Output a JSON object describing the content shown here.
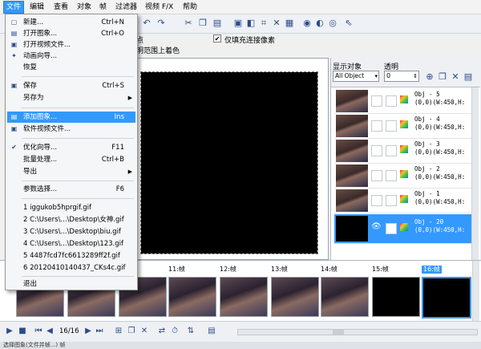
{
  "menubar": {
    "items": [
      {
        "label": "文件",
        "active": true
      },
      {
        "label": "编辑"
      },
      {
        "label": "查看"
      },
      {
        "label": "对象"
      },
      {
        "label": "帧"
      },
      {
        "label": "过滤器"
      },
      {
        "label": "视频 F/X"
      },
      {
        "label": "帮助"
      }
    ]
  },
  "file_menu": {
    "items": [
      {
        "label": "新建...",
        "shortcut": "Ctrl+N",
        "icon": "new-icon"
      },
      {
        "label": "打开图象...",
        "shortcut": "Ctrl+O",
        "icon": "open-icon"
      },
      {
        "label": "打开视频文件...",
        "shortcut": "",
        "icon": "video-open-icon"
      },
      {
        "label": "动画向导...",
        "shortcut": "",
        "icon": "wizard-icon"
      },
      {
        "label": "恢复",
        "shortcut": "",
        "icon": ""
      },
      {
        "label": "保存",
        "shortcut": "Ctrl+S",
        "icon": "save-icon"
      },
      {
        "label": "另存为",
        "shortcut": "",
        "icon": "",
        "submenu": true
      },
      {
        "label": "添加图象...",
        "shortcut": "Ins",
        "icon": "add-image-icon",
        "highlighted": true
      },
      {
        "label": "软件视频文件...",
        "shortcut": "",
        "icon": "video-file-icon"
      },
      {
        "label": "优化向导...",
        "shortcut": "F11",
        "icon": "optimize-icon"
      },
      {
        "label": "批量处理...",
        "shortcut": "Ctrl+B",
        "icon": ""
      },
      {
        "label": "导出",
        "shortcut": "",
        "icon": "",
        "submenu": true
      },
      {
        "label": "参数选择...",
        "shortcut": "F6",
        "icon": ""
      },
      {
        "label": "1 iggukob5hprgif.gif",
        "shortcut": "",
        "icon": ""
      },
      {
        "label": "2 C:\\Users\\...\\Desktop\\女神.gif",
        "shortcut": "",
        "icon": ""
      },
      {
        "label": "3 C:\\Users\\...\\Desktop\\biu.gif",
        "shortcut": "",
        "icon": ""
      },
      {
        "label": "4 C:\\Users\\...\\Desktop\\123.gif",
        "shortcut": "",
        "icon": ""
      },
      {
        "label": "5 4487fcd7fc6613289ff2f.gif",
        "shortcut": "",
        "icon": ""
      },
      {
        "label": "6 20120410140437_CKs4c.gif",
        "shortcut": "",
        "icon": ""
      },
      {
        "label": "退出",
        "shortcut": "",
        "icon": ""
      }
    ],
    "submenu_arrow": "▶"
  },
  "options": {
    "point_label": "点",
    "only_fill_label": "仅填充连接像素",
    "only_fill_checked": "✔",
    "tint_label": "明范围上着色"
  },
  "right_panel": {
    "show_objects_label": "显示对象",
    "transparency_label": "透明",
    "show_objects_value": "All Object",
    "transparency_value": "0",
    "objects": [
      {
        "name": "Obj - 5",
        "coords": "(0,0)(W:450,H:"
      },
      {
        "name": "Obj - 4",
        "coords": "(0,0)(W:450,H:"
      },
      {
        "name": "Obj - 3",
        "coords": "(0,0)(W:450,H:"
      },
      {
        "name": "Obj - 2",
        "coords": "(0,0)(W:450,H:"
      },
      {
        "name": "Obj - 1",
        "coords": "(0,0)(W:450,H:"
      },
      {
        "name": "Obj - 20",
        "coords": "(0,0)(W:450,H:",
        "selected": true
      }
    ]
  },
  "filmstrip": {
    "frames": [
      {
        "label": "",
        "black": false
      },
      {
        "label": "",
        "black": false
      },
      {
        "label": "",
        "black": false
      },
      {
        "label": "11:帧",
        "black": false
      },
      {
        "label": "12:帧",
        "black": false
      },
      {
        "label": "13:帧",
        "black": false
      },
      {
        "label": "14:帧",
        "black": false
      },
      {
        "label": "15:帧",
        "black": true
      },
      {
        "label": "16:帧",
        "black": true,
        "selected": true
      }
    ]
  },
  "controls": {
    "frame_counter": "16/16"
  },
  "status": {
    "text": "选择图象(文件并帧...) 帧"
  },
  "colors": {
    "highlight": "#3399ff",
    "canvas": "#000000"
  }
}
